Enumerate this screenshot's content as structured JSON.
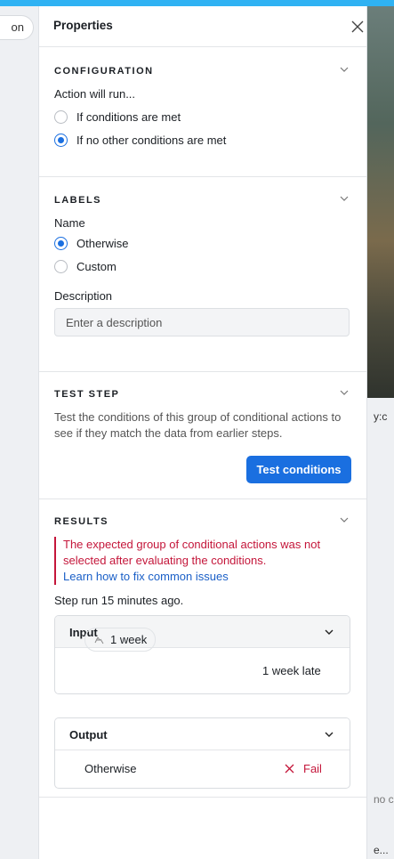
{
  "background": {
    "left_button_text": "on",
    "right_text_1": "y:c",
    "right_text_2": "no c",
    "right_text_3": "e..."
  },
  "panel": {
    "title": "Properties",
    "configuration": {
      "heading": "CONFIGURATION",
      "prompt": "Action will run...",
      "options": [
        {
          "label": "If conditions are met",
          "selected": false
        },
        {
          "label": "If no other conditions are met",
          "selected": true
        }
      ]
    },
    "labels": {
      "heading": "LABELS",
      "name_label": "Name",
      "options": [
        {
          "label": "Otherwise",
          "selected": true
        },
        {
          "label": "Custom",
          "selected": false
        }
      ],
      "description_label": "Description",
      "description_placeholder": "Enter a description"
    },
    "test_step": {
      "heading": "TEST STEP",
      "text": "Test the conditions of this group of conditional actions to see if they match the data from earlier steps.",
      "button": "Test conditions"
    },
    "results": {
      "heading": "RESULTS",
      "error": "The expected group of conditional actions was not selected after evaluating the conditions.",
      "help_link": "Learn how to fix common issues",
      "step_run": "Step run 15 minutes ago.",
      "input": {
        "title": "Input",
        "pill": "1 week",
        "value": "1 week late"
      },
      "output": {
        "title": "Output",
        "value": "Otherwise",
        "status": "Fail"
      }
    }
  },
  "colors": {
    "accent": "#1a6fe0",
    "error": "#c4163a",
    "topbar": "#2fb2f3"
  }
}
